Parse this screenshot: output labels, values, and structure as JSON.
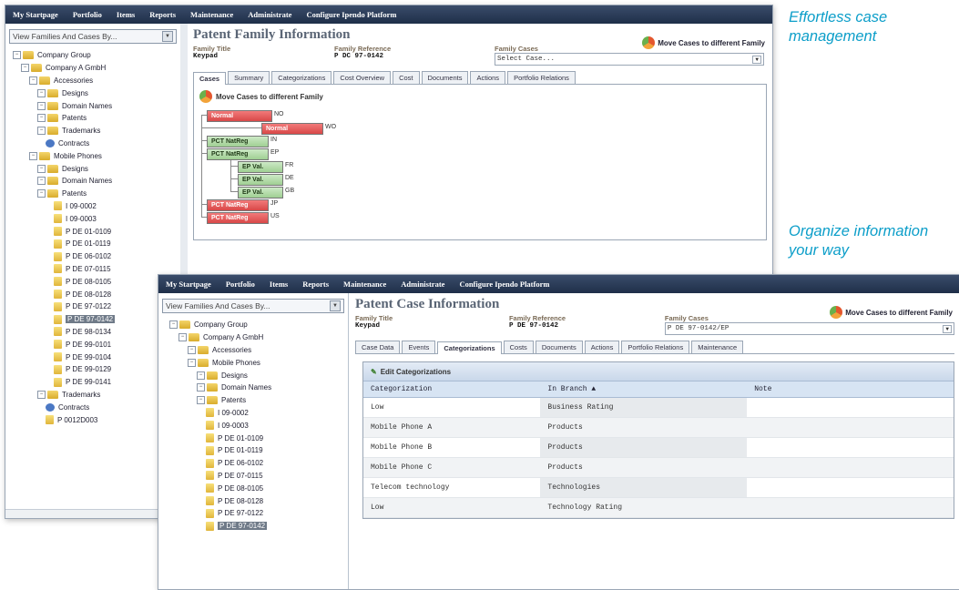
{
  "captions": {
    "top": {
      "line1": "Effortless case",
      "line2": "management"
    },
    "middle": {
      "line1": "Organize information",
      "line2": "your way"
    }
  },
  "colors": {
    "accent_caption": "#0c9ec9",
    "menubar": "#1f2f49",
    "case_red": "#d94848",
    "case_green": "#9fcf93"
  },
  "menu": [
    "My Startpage",
    "Portfolio",
    "Items",
    "Reports",
    "Maintenance",
    "Administrate",
    "Configure Ipendo Platform"
  ],
  "window1": {
    "selector": "View Families And Cases By...",
    "tree": [
      {
        "label": "Company Group",
        "level": 0,
        "icon": "folder"
      },
      {
        "label": "Company A GmbH",
        "level": 1,
        "icon": "folder"
      },
      {
        "label": "Accessories",
        "level": 2,
        "icon": "folder"
      },
      {
        "label": "Designs",
        "level": 3,
        "icon": "folder"
      },
      {
        "label": "Domain Names",
        "level": 3,
        "icon": "folder"
      },
      {
        "label": "Patents",
        "level": 3,
        "icon": "folder"
      },
      {
        "label": "Trademarks",
        "level": 3,
        "icon": "folder"
      },
      {
        "label": "Contracts",
        "level": 4,
        "icon": "contract"
      },
      {
        "label": "Mobile Phones",
        "level": 2,
        "icon": "folder"
      },
      {
        "label": "Designs",
        "level": 3,
        "icon": "folder"
      },
      {
        "label": "Domain Names",
        "level": 3,
        "icon": "folder"
      },
      {
        "label": "Patents",
        "level": 3,
        "icon": "folder"
      },
      {
        "label": "I 09-0002",
        "level": 5,
        "icon": "doc"
      },
      {
        "label": "I 09-0003",
        "level": 5,
        "icon": "doc"
      },
      {
        "label": "P DE 01-0109",
        "level": 5,
        "icon": "doc"
      },
      {
        "label": "P DE 01-0119",
        "level": 5,
        "icon": "doc"
      },
      {
        "label": "P DE 06-0102",
        "level": 5,
        "icon": "doc"
      },
      {
        "label": "P DE 07-0115",
        "level": 5,
        "icon": "doc"
      },
      {
        "label": "P DE 08-0105",
        "level": 5,
        "icon": "doc"
      },
      {
        "label": "P DE 08-0128",
        "level": 5,
        "icon": "doc"
      },
      {
        "label": "P DE 97-0122",
        "level": 5,
        "icon": "doc"
      },
      {
        "label": "P DE 97-0142",
        "level": 5,
        "icon": "doc",
        "selected": true
      },
      {
        "label": "P DE 98-0134",
        "level": 5,
        "icon": "doc"
      },
      {
        "label": "P DE 99-0101",
        "level": 5,
        "icon": "doc"
      },
      {
        "label": "P DE 99-0104",
        "level": 5,
        "icon": "doc"
      },
      {
        "label": "P DE 99-0129",
        "level": 5,
        "icon": "doc"
      },
      {
        "label": "P DE 99-0141",
        "level": 5,
        "icon": "doc"
      },
      {
        "label": "Trademarks",
        "level": 3,
        "icon": "folder"
      },
      {
        "label": "Contracts",
        "level": 4,
        "icon": "contract"
      },
      {
        "label": "P 0012D003",
        "level": 4,
        "icon": "doc"
      }
    ],
    "title": "Patent Family Information",
    "move_button": "Move Cases to different Family",
    "family_title_label": "Family Title",
    "family_title": "Keypad",
    "family_ref_label": "Family Reference",
    "family_ref": "P DC 97-0142",
    "family_cases_label": "Family Cases",
    "family_cases": "Select Case...",
    "tabs": [
      "Cases",
      "Summary",
      "Categorizations",
      "Cost Overview",
      "Cost",
      "Documents",
      "Actions",
      "Portfolio Relations"
    ],
    "cases_panel_title": "Move Cases to different Family",
    "cases": [
      {
        "label": "Normal",
        "color": "red",
        "country": "NO"
      },
      {
        "label": "Normal",
        "color": "red",
        "country": "WO"
      },
      {
        "label": "PCT NatReg",
        "color": "green",
        "country": "IN"
      },
      {
        "label": "PCT NatReg",
        "color": "green",
        "country": "EP"
      },
      {
        "label": "EP Val.",
        "color": "green",
        "country": "FR"
      },
      {
        "label": "EP Val.",
        "color": "green",
        "country": "DE"
      },
      {
        "label": "EP Val.",
        "color": "green",
        "country": "GB"
      },
      {
        "label": "PCT NatReg",
        "color": "red",
        "country": "JP"
      },
      {
        "label": "PCT NatReg",
        "color": "red",
        "country": "US"
      }
    ]
  },
  "window2": {
    "selector": "View Families And Cases By...",
    "tree": [
      {
        "label": "Company Group",
        "level": 0,
        "icon": "folder"
      },
      {
        "label": "Company A GmbH",
        "level": 1,
        "icon": "folder"
      },
      {
        "label": "Accessories",
        "level": 2,
        "icon": "folder"
      },
      {
        "label": "Mobile Phones",
        "level": 2,
        "icon": "folder"
      },
      {
        "label": "Designs",
        "level": 3,
        "icon": "folder"
      },
      {
        "label": "Domain Names",
        "level": 3,
        "icon": "folder"
      },
      {
        "label": "Patents",
        "level": 3,
        "icon": "folder"
      },
      {
        "label": "I 09-0002",
        "level": 4,
        "icon": "doc"
      },
      {
        "label": "I 09-0003",
        "level": 4,
        "icon": "doc"
      },
      {
        "label": "P DE 01-0109",
        "level": 4,
        "icon": "doc"
      },
      {
        "label": "P DE 01-0119",
        "level": 4,
        "icon": "doc"
      },
      {
        "label": "P DE 06-0102",
        "level": 4,
        "icon": "doc"
      },
      {
        "label": "P DE 07-0115",
        "level": 4,
        "icon": "doc"
      },
      {
        "label": "P DE 08-0105",
        "level": 4,
        "icon": "doc"
      },
      {
        "label": "P DE 08-0128",
        "level": 4,
        "icon": "doc"
      },
      {
        "label": "P DE 97-0122",
        "level": 4,
        "icon": "doc"
      },
      {
        "label": "P DE 97-0142",
        "level": 4,
        "icon": "doc",
        "selected": true
      }
    ],
    "title": "Patent Case Information",
    "move_button": "Move Cases to different Family",
    "family_title_label": "Family Title",
    "family_title": "Keypad",
    "family_ref_label": "Family Reference",
    "family_ref": "P DE 97-0142",
    "family_cases_label": "Family Cases",
    "family_cases": "P DE 97-0142/EP",
    "tabs": [
      "Case Data",
      "Events",
      "Categorizations",
      "Costs",
      "Documents",
      "Actions",
      "Portfolio Relations",
      "Maintenance"
    ],
    "edit_label": "Edit Categorizations",
    "columns": [
      "Categorization",
      "In Branch ▲",
      "Note"
    ],
    "rows": [
      [
        "Low",
        "Business Rating",
        ""
      ],
      [
        "Mobile Phone A",
        "Products",
        ""
      ],
      [
        "Mobile Phone B",
        "Products",
        ""
      ],
      [
        "Mobile Phone C",
        "Products",
        ""
      ],
      [
        "Telecom technology",
        "Technologies",
        ""
      ],
      [
        "Low",
        "Technology Rating",
        ""
      ]
    ]
  }
}
